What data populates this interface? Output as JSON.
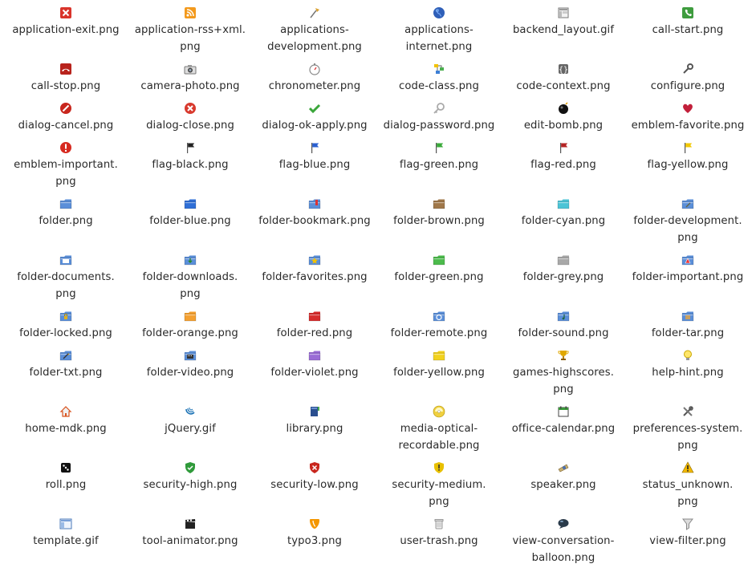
{
  "icons": [
    {
      "name": "application-exit-icon",
      "label": "application-exit.png"
    },
    {
      "name": "application-rss-xml-icon",
      "label": "application-rss+xml.\npng"
    },
    {
      "name": "applications-development-icon",
      "label": "applications-\ndevelopment.png"
    },
    {
      "name": "applications-internet-icon",
      "label": "applications-\ninternet.png"
    },
    {
      "name": "backend-layout-icon",
      "label": "backend_layout.gif"
    },
    {
      "name": "call-start-icon",
      "label": "call-start.png"
    },
    {
      "name": "call-stop-icon",
      "label": "call-stop.png"
    },
    {
      "name": "camera-photo-icon",
      "label": "camera-photo.png"
    },
    {
      "name": "chronometer-icon",
      "label": "chronometer.png"
    },
    {
      "name": "code-class-icon",
      "label": "code-class.png"
    },
    {
      "name": "code-context-icon",
      "label": "code-context.png"
    },
    {
      "name": "configure-icon",
      "label": "configure.png"
    },
    {
      "name": "dialog-cancel-icon",
      "label": "dialog-cancel.png"
    },
    {
      "name": "dialog-close-icon",
      "label": "dialog-close.png"
    },
    {
      "name": "dialog-ok-apply-icon",
      "label": "dialog-ok-apply.png"
    },
    {
      "name": "dialog-password-icon",
      "label": "dialog-password.png"
    },
    {
      "name": "edit-bomb-icon",
      "label": "edit-bomb.png"
    },
    {
      "name": "emblem-favorite-icon",
      "label": "emblem-favorite.png"
    },
    {
      "name": "emblem-important-icon",
      "label": "emblem-important.\npng"
    },
    {
      "name": "flag-black-icon",
      "label": "flag-black.png"
    },
    {
      "name": "flag-blue-icon",
      "label": "flag-blue.png"
    },
    {
      "name": "flag-green-icon",
      "label": "flag-green.png"
    },
    {
      "name": "flag-red-icon",
      "label": "flag-red.png"
    },
    {
      "name": "flag-yellow-icon",
      "label": "flag-yellow.png"
    },
    {
      "name": "folder-icon",
      "label": "folder.png"
    },
    {
      "name": "folder-blue-icon",
      "label": "folder-blue.png"
    },
    {
      "name": "folder-bookmark-icon",
      "label": "folder-bookmark.png"
    },
    {
      "name": "folder-brown-icon",
      "label": "folder-brown.png"
    },
    {
      "name": "folder-cyan-icon",
      "label": "folder-cyan.png"
    },
    {
      "name": "folder-development-icon",
      "label": "folder-development.\npng"
    },
    {
      "name": "folder-documents-icon",
      "label": "folder-documents.\npng"
    },
    {
      "name": "folder-downloads-icon",
      "label": "folder-downloads.\npng"
    },
    {
      "name": "folder-favorites-icon",
      "label": "folder-favorites.png"
    },
    {
      "name": "folder-green-icon",
      "label": "folder-green.png"
    },
    {
      "name": "folder-grey-icon",
      "label": "folder-grey.png"
    },
    {
      "name": "folder-important-icon",
      "label": "folder-important.png"
    },
    {
      "name": "folder-locked-icon",
      "label": "folder-locked.png"
    },
    {
      "name": "folder-orange-icon",
      "label": "folder-orange.png"
    },
    {
      "name": "folder-red-icon",
      "label": "folder-red.png"
    },
    {
      "name": "folder-remote-icon",
      "label": "folder-remote.png"
    },
    {
      "name": "folder-sound-icon",
      "label": "folder-sound.png"
    },
    {
      "name": "folder-tar-icon",
      "label": "folder-tar.png"
    },
    {
      "name": "folder-txt-icon",
      "label": "folder-txt.png"
    },
    {
      "name": "folder-video-icon",
      "label": "folder-video.png"
    },
    {
      "name": "folder-violet-icon",
      "label": "folder-violet.png"
    },
    {
      "name": "folder-yellow-icon",
      "label": "folder-yellow.png"
    },
    {
      "name": "games-highscores-icon",
      "label": "games-highscores.\npng"
    },
    {
      "name": "help-hint-icon",
      "label": "help-hint.png"
    },
    {
      "name": "home-mdk-icon",
      "label": "home-mdk.png"
    },
    {
      "name": "jquery-icon",
      "label": "jQuery.gif"
    },
    {
      "name": "library-icon",
      "label": "library.png"
    },
    {
      "name": "media-optical-recordable-icon",
      "label": "media-optical-\nrecordable.png"
    },
    {
      "name": "office-calendar-icon",
      "label": "office-calendar.png"
    },
    {
      "name": "preferences-system-icon",
      "label": "preferences-system.\npng"
    },
    {
      "name": "roll-icon",
      "label": "roll.png"
    },
    {
      "name": "security-high-icon",
      "label": "security-high.png"
    },
    {
      "name": "security-low-icon",
      "label": "security-low.png"
    },
    {
      "name": "security-medium-icon",
      "label": "security-medium.\npng"
    },
    {
      "name": "speaker-icon",
      "label": "speaker.png"
    },
    {
      "name": "status-unknown-icon",
      "label": "status_unknown.\npng"
    },
    {
      "name": "template-icon",
      "label": "template.gif"
    },
    {
      "name": "tool-animator-icon",
      "label": "tool-animator.png"
    },
    {
      "name": "typo3-icon",
      "label": "typo3.png"
    },
    {
      "name": "user-trash-icon",
      "label": "user-trash.png"
    },
    {
      "name": "view-conversation-balloon-icon",
      "label": "view-conversation-\nballoon.png"
    },
    {
      "name": "view-filter-icon",
      "label": "view-filter.png"
    }
  ],
  "colors": {
    "text": "#2a2a2a",
    "folder_default": "#5b8fd9",
    "folder_brown": "#a0784a",
    "folder_cyan": "#4cc4d6",
    "folder_green": "#4cbb4c",
    "folder_grey": "#a8a8a8",
    "folder_orange": "#f4a030",
    "folder_red": "#d62c2c",
    "folder_violet": "#9a6cd6",
    "folder_yellow": "#f2d21e"
  }
}
